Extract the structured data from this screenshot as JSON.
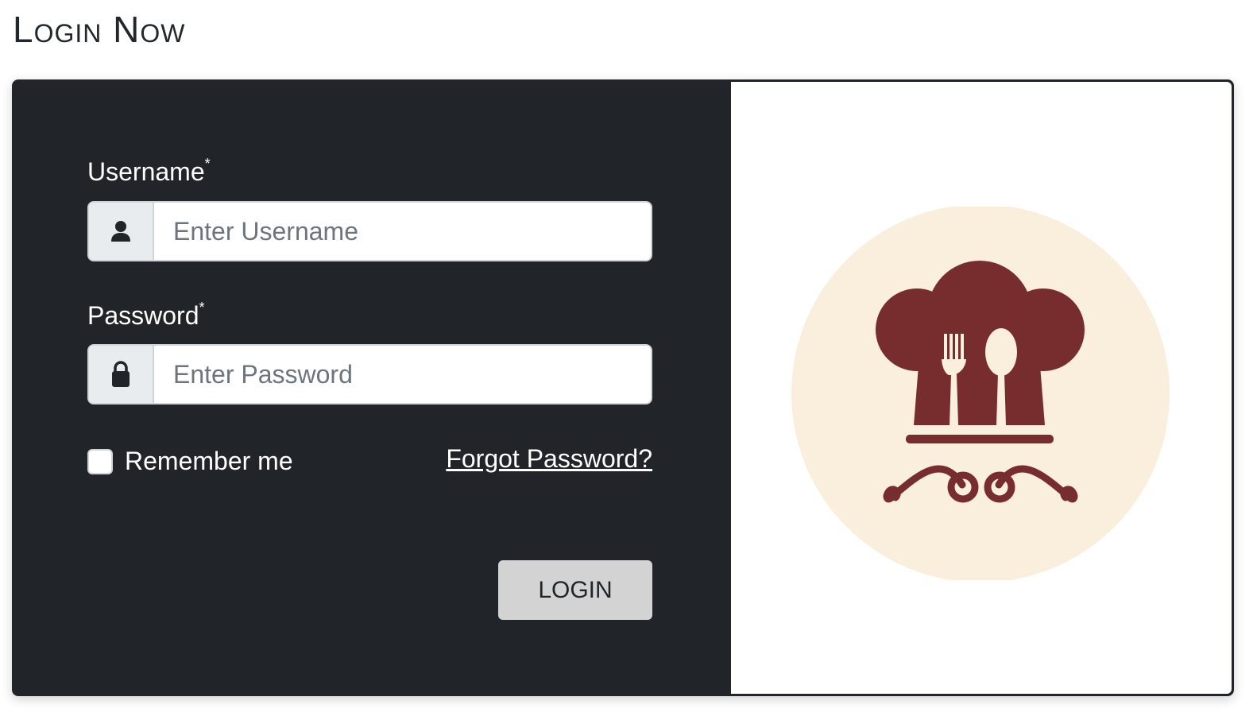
{
  "page": {
    "title": "Login Now"
  },
  "form": {
    "username": {
      "label": "Username",
      "required_mark": "*",
      "placeholder": "Enter Username",
      "icon": "user-icon"
    },
    "password": {
      "label": "Password",
      "required_mark": "*",
      "placeholder": "Enter Password",
      "icon": "lock-icon"
    },
    "remember_label": "Remember me",
    "forgot_label": "Forgot Password?",
    "login_label": "LOGIN"
  },
  "colors": {
    "panel_bg": "#212429",
    "logo_circle": "#faeedd",
    "logo_brand": "#772d2d",
    "button_bg": "#d3d3d3"
  },
  "logo": {
    "icon": "chef-hat-fork-spoon-logo"
  }
}
